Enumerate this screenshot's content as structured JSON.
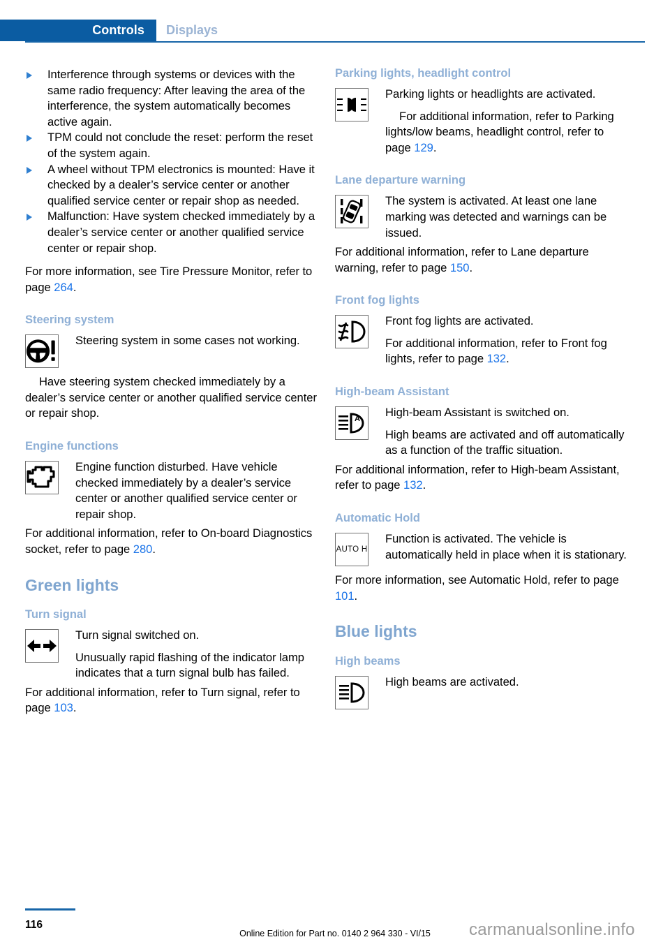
{
  "header": {
    "active_tab": "Controls",
    "inactive_tab": "Displays"
  },
  "left_column": {
    "bullets": [
      "Interference through systems or devices with the same radio frequency: After leaving the area of the interference, the system automatically becomes active again.",
      "TPM could not conclude the reset: perform the reset of the system again.",
      "A wheel without TPM electronics is mounted: Have it checked by a dealer’s service center or another qualified service center or repair shop as needed.",
      "Malfunction: Have system checked immediately by a dealer’s service center or another qualified service center or repair shop."
    ],
    "tpm_note_prefix": "For more information, see Tire Pressure Monitor, refer to page ",
    "tpm_note_ref": "264",
    "tpm_note_suffix": ".",
    "steering": {
      "heading": "Steering system",
      "icon": "steering-wheel-warning-icon",
      "line1": "Steering system in some cases not working.",
      "line2": "Have steering system checked immediately by a dealer’s service center or another qualified service center or repair shop."
    },
    "engine": {
      "heading": "Engine functions",
      "icon": "check-engine-icon",
      "line1": "Engine function disturbed. Have vehicle checked immediately by a dealer’s service center or another qualified service center or repair shop.",
      "note_prefix": "For additional information, refer to On-board Diagnostics socket, refer to page ",
      "note_ref": "280",
      "note_suffix": "."
    },
    "green_lights": {
      "heading": "Green lights",
      "turn_signal": {
        "heading": "Turn signal",
        "icon": "turn-signal-arrows-icon",
        "line1": "Turn signal switched on.",
        "line2": "Unusually rapid flashing of the indicator lamp indicates that a turn signal bulb has failed.",
        "note_prefix": "For additional information, refer to Turn signal, refer to page ",
        "note_ref": "103",
        "note_suffix": "."
      }
    }
  },
  "right_column": {
    "parking_lights": {
      "heading": "Parking lights, headlight control",
      "icon": "parking-lights-icon",
      "line1": "Parking lights or headlights are activated.",
      "line2_prefix": "For additional information, refer to Parking lights/low beams, headlight control, refer to page ",
      "line2_ref": "129",
      "line2_suffix": "."
    },
    "lane_departure": {
      "heading": "Lane departure warning",
      "icon": "lane-departure-warning-icon",
      "line1": "The system is activated. At least one lane marking was detected and warnings can be issued.",
      "note_prefix": "For additional information, refer to Lane departure warning, refer to page ",
      "note_ref": "150",
      "note_suffix": "."
    },
    "front_fog": {
      "heading": "Front fog lights",
      "icon": "front-fog-light-icon",
      "line1": "Front fog lights are activated.",
      "line2_prefix": "For additional information, refer to Front fog lights, refer to page ",
      "line2_ref": "132",
      "line2_suffix": "."
    },
    "high_beam_assistant": {
      "heading": "High-beam Assistant",
      "icon": "high-beam-assistant-icon",
      "line1": "High-beam Assistant is switched on.",
      "line2": "High beams are activated and off automatically as a function of the traffic situation.",
      "note_prefix": "For additional information, refer to High-beam Assistant, refer to page ",
      "note_ref": "132",
      "note_suffix": "."
    },
    "automatic_hold": {
      "heading": "Automatic Hold",
      "icon": "auto-hold-icon",
      "icon_label": "AUTO H",
      "line1": "Function is activated. The vehicle is automatically held in place when it is stationary.",
      "note_prefix": "For more information, see Automatic Hold, refer to page ",
      "note_ref": "101",
      "note_suffix": "."
    },
    "blue_lights": {
      "heading": "Blue lights",
      "high_beams": {
        "heading": "High beams",
        "icon": "high-beam-icon",
        "line1": "High beams are activated."
      }
    }
  },
  "footer": {
    "page_number": "116",
    "edition": "Online Edition for Part no. 0140 2 964 330 - VI/15",
    "watermark": "carmanualsonline.info"
  },
  "colors": {
    "tab_active_bg": "#0b5ca2",
    "tab_inactive_text": "#9bb4d4",
    "heading_blue": "#8fb0d6",
    "page_ref_blue": "#1a73e8",
    "rule_blue": "#1765a8"
  }
}
